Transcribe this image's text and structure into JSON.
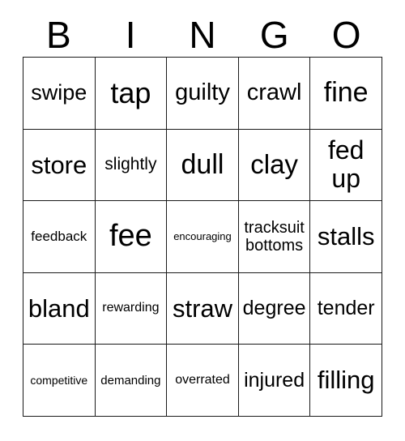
{
  "card": {
    "title": "Bingo Card",
    "background_color": "#ffffff",
    "text_color": "#000000",
    "border_color": "#1a1a1a",
    "rows": 5,
    "columns": 5
  },
  "header": {
    "letters": [
      {
        "label": "B"
      },
      {
        "label": "I"
      },
      {
        "label": "N"
      },
      {
        "label": "G"
      },
      {
        "label": "O"
      }
    ]
  },
  "grid": {
    "cells": [
      {
        "text": "swipe",
        "row": 1,
        "col": 1,
        "column_letter": "B",
        "font_size": 27,
        "lines": 1
      },
      {
        "text": "tap",
        "row": 1,
        "col": 2,
        "column_letter": "I",
        "font_size": 36,
        "lines": 1
      },
      {
        "text": "guilty",
        "row": 1,
        "col": 3,
        "column_letter": "N",
        "font_size": 29,
        "lines": 1
      },
      {
        "text": "crawl",
        "row": 1,
        "col": 4,
        "column_letter": "G",
        "font_size": 29,
        "lines": 1
      },
      {
        "text": "fine",
        "row": 1,
        "col": 5,
        "column_letter": "O",
        "font_size": 34,
        "lines": 1
      },
      {
        "text": "store",
        "row": 2,
        "col": 1,
        "column_letter": "B",
        "font_size": 31,
        "lines": 1
      },
      {
        "text": "slightly",
        "row": 2,
        "col": 2,
        "column_letter": "I",
        "font_size": 21,
        "lines": 1
      },
      {
        "text": "dull",
        "row": 2,
        "col": 3,
        "column_letter": "N",
        "font_size": 34,
        "lines": 1
      },
      {
        "text": "clay",
        "row": 2,
        "col": 4,
        "column_letter": "G",
        "font_size": 33,
        "lines": 1
      },
      {
        "text": "fed up",
        "row": 2,
        "col": 5,
        "column_letter": "O",
        "font_size": 32,
        "lines": 2
      },
      {
        "text": "feedback",
        "row": 3,
        "col": 1,
        "column_letter": "B",
        "font_size": 17,
        "lines": 1
      },
      {
        "text": "fee",
        "row": 3,
        "col": 2,
        "column_letter": "I",
        "font_size": 38,
        "lines": 1
      },
      {
        "text": "encouraging",
        "row": 3,
        "col": 3,
        "column_letter": "N",
        "font_size": 13,
        "lines": 1
      },
      {
        "text": "tracksuit bottoms",
        "row": 3,
        "col": 4,
        "column_letter": "G",
        "font_size": 20,
        "lines": 2
      },
      {
        "text": "stalls",
        "row": 3,
        "col": 5,
        "column_letter": "O",
        "font_size": 31,
        "lines": 1
      },
      {
        "text": "bland",
        "row": 4,
        "col": 1,
        "column_letter": "B",
        "font_size": 31,
        "lines": 1
      },
      {
        "text": "rewarding",
        "row": 4,
        "col": 2,
        "column_letter": "I",
        "font_size": 16,
        "lines": 1
      },
      {
        "text": "straw",
        "row": 4,
        "col": 3,
        "column_letter": "N",
        "font_size": 31,
        "lines": 1
      },
      {
        "text": "degree",
        "row": 4,
        "col": 4,
        "column_letter": "G",
        "font_size": 25,
        "lines": 1
      },
      {
        "text": "tender",
        "row": 4,
        "col": 5,
        "column_letter": "O",
        "font_size": 25,
        "lines": 1
      },
      {
        "text": "competitive",
        "row": 5,
        "col": 1,
        "column_letter": "B",
        "font_size": 14,
        "lines": 1
      },
      {
        "text": "demanding",
        "row": 5,
        "col": 2,
        "column_letter": "I",
        "font_size": 15,
        "lines": 1
      },
      {
        "text": "overrated",
        "row": 5,
        "col": 3,
        "column_letter": "N",
        "font_size": 16,
        "lines": 1
      },
      {
        "text": "injured",
        "row": 5,
        "col": 4,
        "column_letter": "G",
        "font_size": 25,
        "lines": 1
      },
      {
        "text": "filling",
        "row": 5,
        "col": 5,
        "column_letter": "O",
        "font_size": 31,
        "lines": 1
      }
    ]
  }
}
